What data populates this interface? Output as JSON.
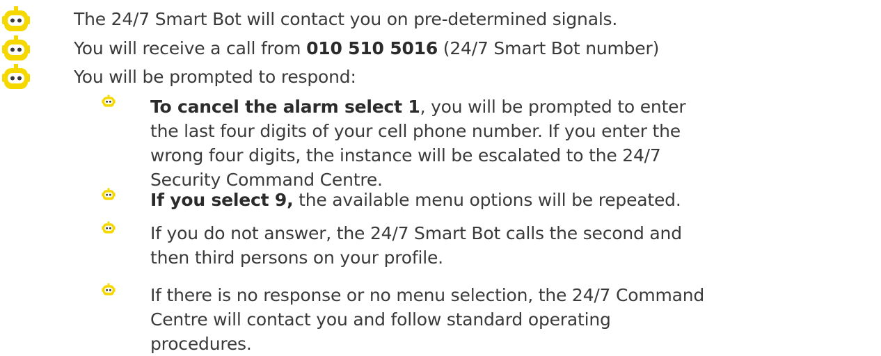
{
  "colors": {
    "bot_yellow": "#F5D800",
    "bot_dark": "#3a3a3a",
    "text": "#3a3a3a"
  },
  "icons": {
    "bullet": "robot-head-icon"
  },
  "main_items": [
    {
      "pre": "The 24/7 Smart Bot will contact you on pre-determined signals.",
      "bold": "",
      "post": ""
    },
    {
      "pre": "You will receive a call from ",
      "bold": "010 510 5016",
      "post": " (24/7 Smart Bot number)"
    },
    {
      "pre": "You will be prompted to respond:",
      "bold": "",
      "post": ""
    }
  ],
  "sub_items": [
    {
      "bold": "To cancel the alarm select 1",
      "text": ", you will be prompted to enter the last four digits of your cell phone number. If you enter the wrong four digits, the instance will be escalated to the 24/7 Security Command Centre."
    },
    {
      "bold": "If you select 9,",
      "text": " the available menu options will be repeated."
    },
    {
      "bold": "",
      "text": "If you do not answer, the 24/7 Smart Bot calls the second and then third persons on your profile."
    },
    {
      "bold": "",
      "text": "If there is no response or no menu selection, the 24/7 Command Centre will contact you  and follow standard operating procedures."
    }
  ]
}
